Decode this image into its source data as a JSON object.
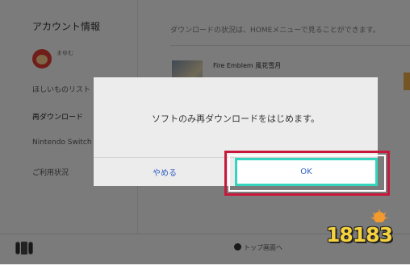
{
  "sidebar": {
    "title": "アカウント情報",
    "user": {
      "name": "まゆむ",
      "sub": ""
    },
    "items": [
      "ほしいものリスト",
      "再ダウンロード",
      "Nintendo Switch",
      "ご利用状況"
    ]
  },
  "main": {
    "info_text": "ダウンロードの状況は、HOMEメニューで見ることができます。",
    "game_title": "Fire Emblem 風花雪月"
  },
  "bottom_bar": {
    "home_hint": "トップ画面へ"
  },
  "dialog": {
    "message": "ソフトのみ再ダウンロードをはじめます。",
    "cancel_label": "やめる",
    "ok_label": "OK"
  },
  "watermark": {
    "text": "18183"
  },
  "colors": {
    "accent": "#34d4be",
    "link": "#3460c4",
    "highlight": "#c7183c",
    "orange": "#e2a446"
  },
  "icons": [
    "avatar",
    "switch-icon",
    "button-a-icon",
    "crown-icon"
  ]
}
